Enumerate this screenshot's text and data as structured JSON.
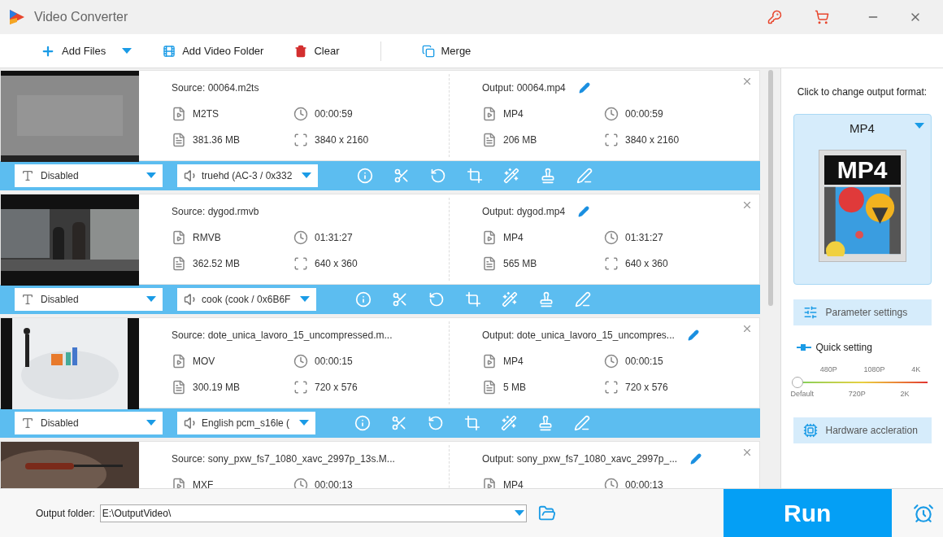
{
  "window": {
    "title": "Video Converter"
  },
  "toolbar": [
    {
      "kind": "add",
      "label": "Add Files"
    },
    {
      "kind": "folder",
      "label": "Add Video Folder"
    },
    {
      "kind": "clear",
      "label": "Clear"
    },
    {
      "kind": "merge",
      "label": "Merge"
    }
  ],
  "files": [
    {
      "source": "Source: 00064.m2ts",
      "output": "Output: 00064.mp4",
      "src_format": "M2TS",
      "src_duration": "00:00:59",
      "src_size": "381.36 MB",
      "src_resolution": "3840 x 2160",
      "out_format": "MP4",
      "out_duration": "00:00:59",
      "out_size": "206 MB",
      "out_resolution": "3840 x 2160",
      "subtitle": "Disabled",
      "audio": "truehd (AC-3 / 0x332"
    },
    {
      "source": "Source: dygod.rmvb",
      "output": "Output: dygod.mp4",
      "src_format": "RMVB",
      "src_duration": "01:31:27",
      "src_size": "362.52 MB",
      "src_resolution": "640 x 360",
      "out_format": "MP4",
      "out_duration": "01:31:27",
      "out_size": "565 MB",
      "out_resolution": "640 x 360",
      "subtitle": "Disabled",
      "audio": "cook (cook / 0x6B6F"
    },
    {
      "source": "Source: dote_unica_lavoro_15_uncompressed.m...",
      "output": "Output: dote_unica_lavoro_15_uncompres...",
      "src_format": "MOV",
      "src_duration": "00:00:15",
      "src_size": "300.19 MB",
      "src_resolution": "720 x 576",
      "out_format": "MP4",
      "out_duration": "00:00:15",
      "out_size": "5 MB",
      "out_resolution": "720 x 576",
      "subtitle": "Disabled",
      "audio": "English pcm_s16le ("
    },
    {
      "source": "Source: sony_pxw_fs7_1080_xavc_2997p_13s.M...",
      "output": "Output: sony_pxw_fs7_1080_xavc_2997p_...",
      "src_format": "MXF",
      "src_duration": "00:00:13",
      "out_format": "MP4",
      "out_duration": "00:00:13"
    }
  ],
  "output_panel": {
    "hint": "Click to change output format:",
    "format": "MP4",
    "image_label": "MP4",
    "parameter_settings": "Parameter settings",
    "quick_setting": "Quick setting",
    "quality": {
      "level": 0,
      "top_labels": [
        "480P",
        "1080P",
        "4K"
      ],
      "bottom_labels": [
        "Default",
        "720P",
        "2K"
      ]
    },
    "hardware": "Hardware accleration"
  },
  "bottom": {
    "label": "Output folder:",
    "path": "E:\\OutputVideo\\",
    "run": "Run"
  }
}
